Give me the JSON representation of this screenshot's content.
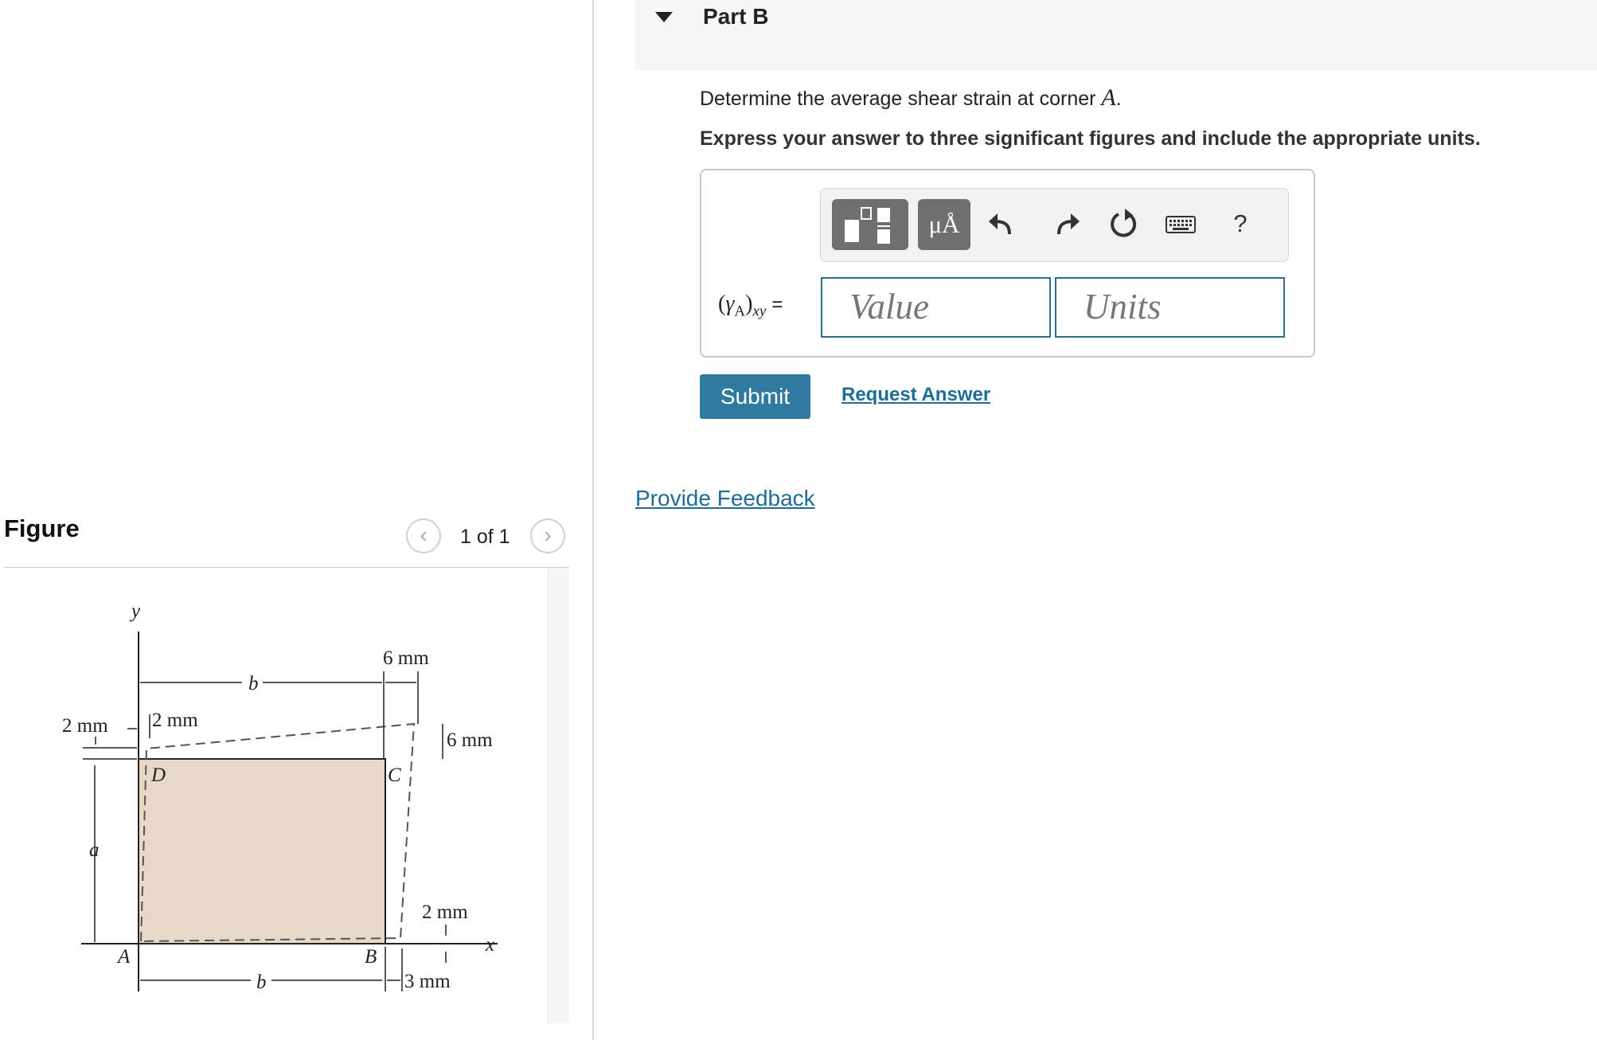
{
  "figure": {
    "title": "Figure",
    "pager": {
      "prev_icon": "chevron-left-icon",
      "count": "1 of 1",
      "next_icon": "chevron-right-icon"
    },
    "labels": {
      "y_axis": "y",
      "x_axis": "x",
      "corner_a": "A",
      "corner_b": "B",
      "corner_c": "C",
      "corner_d": "D",
      "dim_a": "a",
      "dim_b_top": "b",
      "dim_b_bottom": "b",
      "left_2mm": "2 mm",
      "top_2mm": "2 mm",
      "top_6mm": "6 mm",
      "right_6mm": "6 mm",
      "right_2mm": "2 mm",
      "bottom_3mm": "3 mm"
    },
    "plate_color": "#e8d8c7"
  },
  "part": {
    "collapse_icon": "triangle-down-icon",
    "title": "Part B",
    "question_prefix": "Determine the average shear strain at corner ",
    "question_symbol": "A",
    "question_suffix": ".",
    "instruction": "Express your answer to three significant figures and include the appropriate units."
  },
  "toolbar": {
    "template_icon": "templates-icon",
    "units_label": "μÅ",
    "undo_icon": "undo-icon",
    "redo_icon": "redo-icon",
    "reset_icon": "reset-icon",
    "keyboard_icon": "keyboard-icon",
    "help_label": "?"
  },
  "answer": {
    "symbol": "γ",
    "subscript_a": "A",
    "subscript_xy": "xy",
    "equals": "=",
    "value_placeholder": "Value",
    "units_placeholder": "Units"
  },
  "actions": {
    "submit_label": "Submit",
    "request_answer_label": "Request Answer",
    "feedback_label": "Provide Feedback"
  },
  "colors": {
    "accent": "#2f7a9f",
    "link": "#1d6d96",
    "field_border": "#2d6f8f"
  }
}
